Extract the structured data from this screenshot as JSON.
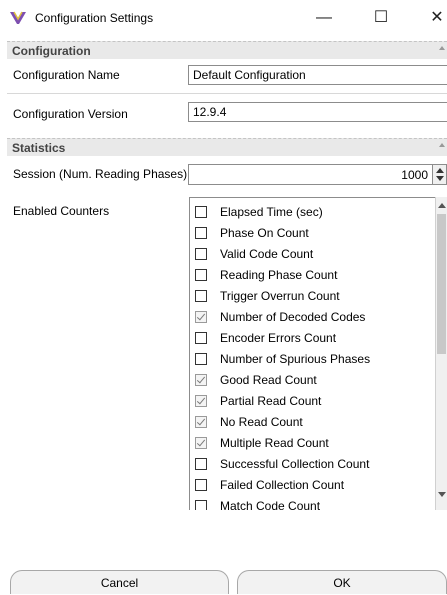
{
  "window": {
    "title": "Configuration Settings",
    "minimize_glyph": "—",
    "maximize_glyph": "☐",
    "close_glyph": "✕",
    "app_icon": "wings-logo-icon",
    "app_icon_color": "#7d4fb0"
  },
  "sections": {
    "configuration": "Configuration",
    "statistics": "Statistics"
  },
  "configuration": {
    "name_label": "Configuration Name",
    "name_value": "Default Configuration",
    "version_label": "Configuration Version",
    "version_value": "12.9.4"
  },
  "statistics": {
    "session_label": "Session (Num. Reading Phases)",
    "session_value": "1000",
    "counters_label": "Enabled Counters",
    "counters": [
      {
        "label": "Elapsed Time (sec)",
        "checked": false
      },
      {
        "label": "Phase On Count",
        "checked": false
      },
      {
        "label": "Valid Code Count",
        "checked": false
      },
      {
        "label": "Reading Phase Count",
        "checked": false
      },
      {
        "label": "Trigger Overrun Count",
        "checked": false
      },
      {
        "label": "Number of Decoded Codes",
        "checked": true
      },
      {
        "label": "Encoder Errors Count",
        "checked": false
      },
      {
        "label": "Number of Spurious Phases",
        "checked": false
      },
      {
        "label": "Good Read Count",
        "checked": true
      },
      {
        "label": "Partial Read Count",
        "checked": true
      },
      {
        "label": "No Read Count",
        "checked": true
      },
      {
        "label": "Multiple Read Count",
        "checked": true
      },
      {
        "label": "Successful Collection Count",
        "checked": false
      },
      {
        "label": "Failed Collection Count",
        "checked": false
      },
      {
        "label": "Match Code Count",
        "checked": false
      }
    ]
  },
  "buttons": {
    "cancel": "Cancel",
    "ok": "OK"
  }
}
